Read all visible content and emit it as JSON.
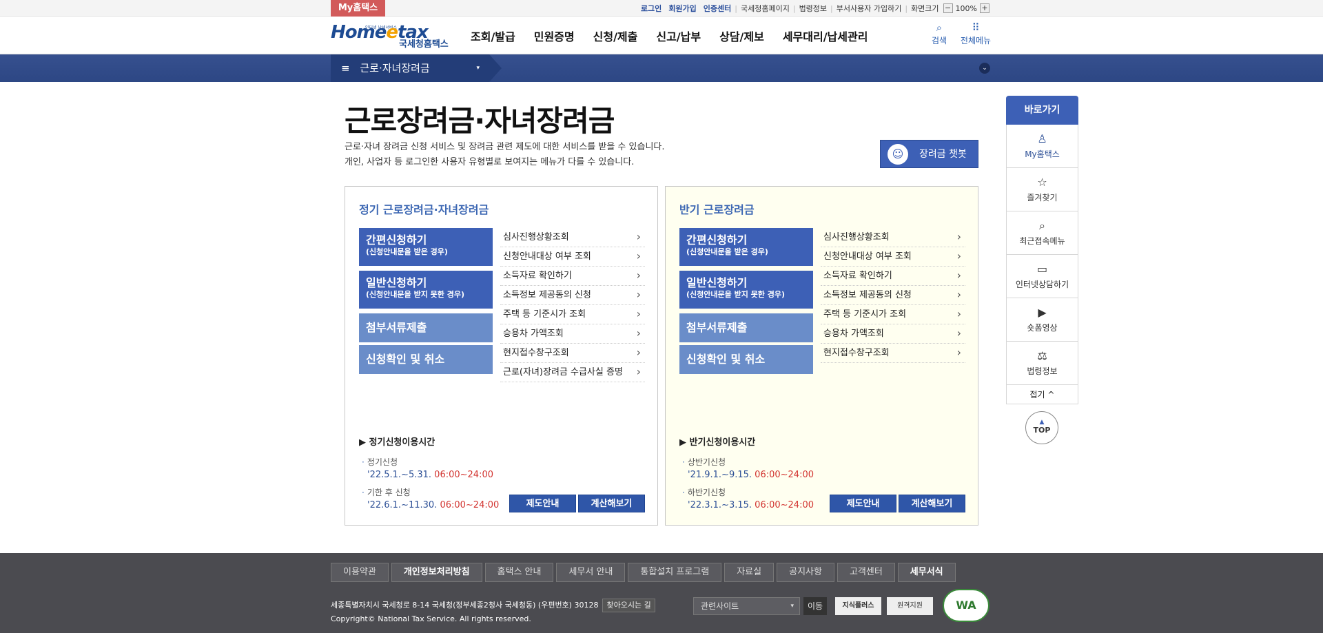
{
  "topbar": {
    "my_label": "My홈택스",
    "links": [
      "로그인",
      "회원가입",
      "인증센터",
      "국세청홈페이지",
      "법령정보",
      "부서사용자 가입하기"
    ],
    "text_size": "화면크기",
    "zoom_minus": "−",
    "zoom_value": "100%",
    "zoom_plus": "+"
  },
  "header": {
    "logo_text": "Home",
    "logo_e": "e",
    "logo_tail": "tax",
    "logo_sub": "국세청홈택스",
    "logo_tiny": "인터넷 납세서비스",
    "nav": [
      "조회/발급",
      "민원증명",
      "신청/제출",
      "신고/납부",
      "상담/제보",
      "세무대리/납세관리"
    ],
    "search_label": "검색",
    "allmenu_label": "전체메뉴",
    "search_icon": "search-icon",
    "allmenu_icon": "grid-icon"
  },
  "subbar": {
    "selected": "근로·자녀장려금",
    "ham": "≡",
    "caret": "▾",
    "chev": "⌄"
  },
  "page": {
    "title": "근로장려금·자녀장려금",
    "desc1": "근로·자녀 장려금 신청 서비스 및 장려금 관련 제도에 대한 서비스를 받을 수 있습니다.",
    "desc2": "개인, 사업자 등 로그인한 사용자 유형별로 보여지는 메뉴가 다를 수 있습니다.",
    "chatbot": "장려금 챗봇"
  },
  "left": {
    "title": "정기 근로장려금·자녀장려금",
    "btn1": {
      "l1": "간편신청하기",
      "l2": "(신청안내문을 받은 경우)"
    },
    "btn2": {
      "l1": "일반신청하기",
      "l2": "(신청안내문을 받지 못한 경우)"
    },
    "btn3": "첨부서류제출",
    "btn4": "신청확인 및 취소",
    "links": [
      "심사진행상황조회",
      "신청안내대상 여부 조회",
      "소득자료 확인하기",
      "소득정보 제공동의 신청",
      "주택 등 기준시가 조회",
      "승용차 가액조회",
      "현지접수창구조회",
      "근로(자녀)장려금 수급사실 증명"
    ],
    "hours_title": "▶ 정기신청이용시간",
    "i1": "정기신청",
    "d1": "'22.5.1.~5.31.",
    "t1": "06:00~24:00",
    "i2": "기한 후 신청",
    "d2": "'22.6.1.~11.30.",
    "t2": "06:00~24:00",
    "guide": "제도안내",
    "calc": "계산해보기"
  },
  "right": {
    "title": "반기 근로장려금",
    "btn1": {
      "l1": "간편신청하기",
      "l2": "(신청안내문을 받은 경우)"
    },
    "btn2": {
      "l1": "일반신청하기",
      "l2": "(신청안내문을 받지 못한 경우)"
    },
    "btn3": "첨부서류제출",
    "btn4": "신청확인 및 취소",
    "links": [
      "심사진행상황조회",
      "신청안내대상 여부 조회",
      "소득자료 확인하기",
      "소득정보 제공동의 신청",
      "주택 등 기준시가 조회",
      "승용차 가액조회",
      "현지접수창구조회"
    ],
    "hours_title": "▶ 반기신청이용시간",
    "i1": "상반기신청",
    "d1": "'21.9.1.~9.15.",
    "t1": "06:00~24:00",
    "i2": "하반기신청",
    "d2": "'22.3.1.~3.15.",
    "t2": "06:00~24:00",
    "guide": "제도안내",
    "calc": "계산해보기"
  },
  "quick": {
    "header": "바로가기",
    "items": [
      {
        "label": "My홈택스",
        "icon": "person-icon",
        "glyph": "♙"
      },
      {
        "label": "즐겨찾기",
        "icon": "star-icon",
        "glyph": "☆"
      },
      {
        "label": "최근접속메뉴",
        "icon": "recent-search-icon",
        "glyph": "⌕"
      },
      {
        "label": "인터넷상담하기",
        "icon": "laptop-check-icon",
        "glyph": "▭"
      },
      {
        "label": "숏폼영상",
        "icon": "play-icon",
        "glyph": "▶"
      },
      {
        "label": "법령정보",
        "icon": "gavel-icon",
        "glyph": "⚖"
      }
    ],
    "fold": "접기 ^",
    "top": "TOP",
    "top_arrow": "▲"
  },
  "footer": {
    "links": [
      "이용약관",
      "개인정보처리방침",
      "홈택스 안내",
      "세무서 안내",
      "통합설치 프로그램",
      "자료실",
      "공지사항",
      "고객센터",
      "세무서식"
    ],
    "address": "세종특별자치시 국세청로 8-14 국세청(정부세종2청사 국세청동) (우편번호) 30128",
    "findway": "찾아오시는 길",
    "copyright": "Copyright© National Tax Service. All rights reserved.",
    "related": "관련사이트",
    "related_caret": "▾",
    "go": "이동",
    "badge1": "지식플러스",
    "badge2": "원격지원",
    "wa": "WA"
  }
}
